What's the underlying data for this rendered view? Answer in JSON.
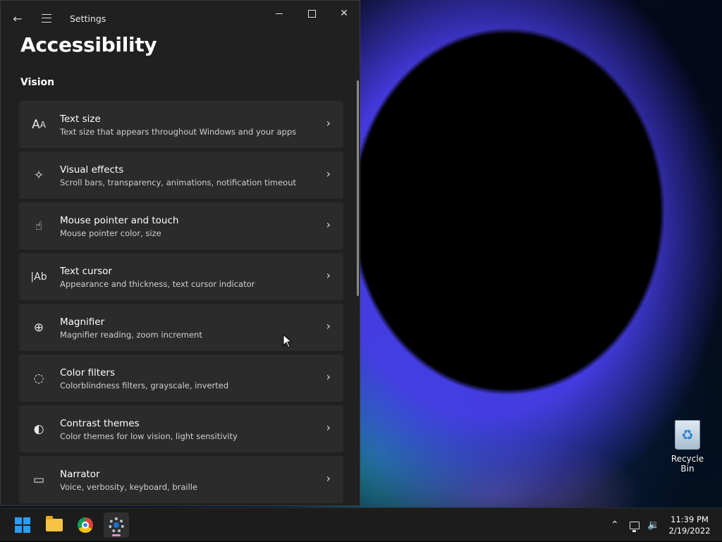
{
  "window": {
    "app_title": "Settings",
    "page_title": "Accessibility",
    "section_title": "Vision"
  },
  "items": [
    {
      "icon": "text-size-icon",
      "glyph": "A",
      "name": "Text size",
      "desc": "Text size that appears throughout Windows and your apps"
    },
    {
      "icon": "sparkle-icon",
      "glyph": "✧",
      "name": "Visual effects",
      "desc": "Scroll bars, transparency, animations, notification timeout"
    },
    {
      "icon": "pointer-touch-icon",
      "glyph": "☝",
      "name": "Mouse pointer and touch",
      "desc": "Mouse pointer color, size"
    },
    {
      "icon": "text-cursor-icon",
      "glyph": "|Ab",
      "name": "Text cursor",
      "desc": "Appearance and thickness, text cursor indicator"
    },
    {
      "icon": "magnifier-icon",
      "glyph": "⊕",
      "name": "Magnifier",
      "desc": "Magnifier reading, zoom increment"
    },
    {
      "icon": "color-palette-icon",
      "glyph": "◌",
      "name": "Color filters",
      "desc": "Colorblindness filters, grayscale, inverted"
    },
    {
      "icon": "contrast-icon",
      "glyph": "◐",
      "name": "Contrast themes",
      "desc": "Color themes for low vision, light sensitivity"
    },
    {
      "icon": "narrator-icon",
      "glyph": "▭",
      "name": "Narrator",
      "desc": "Voice, verbosity, keyboard, braille"
    }
  ],
  "desktop": {
    "recycle_bin_label": "Recycle Bin"
  },
  "taskbar": {
    "time": "11:39 PM",
    "date": "2/19/2022"
  }
}
